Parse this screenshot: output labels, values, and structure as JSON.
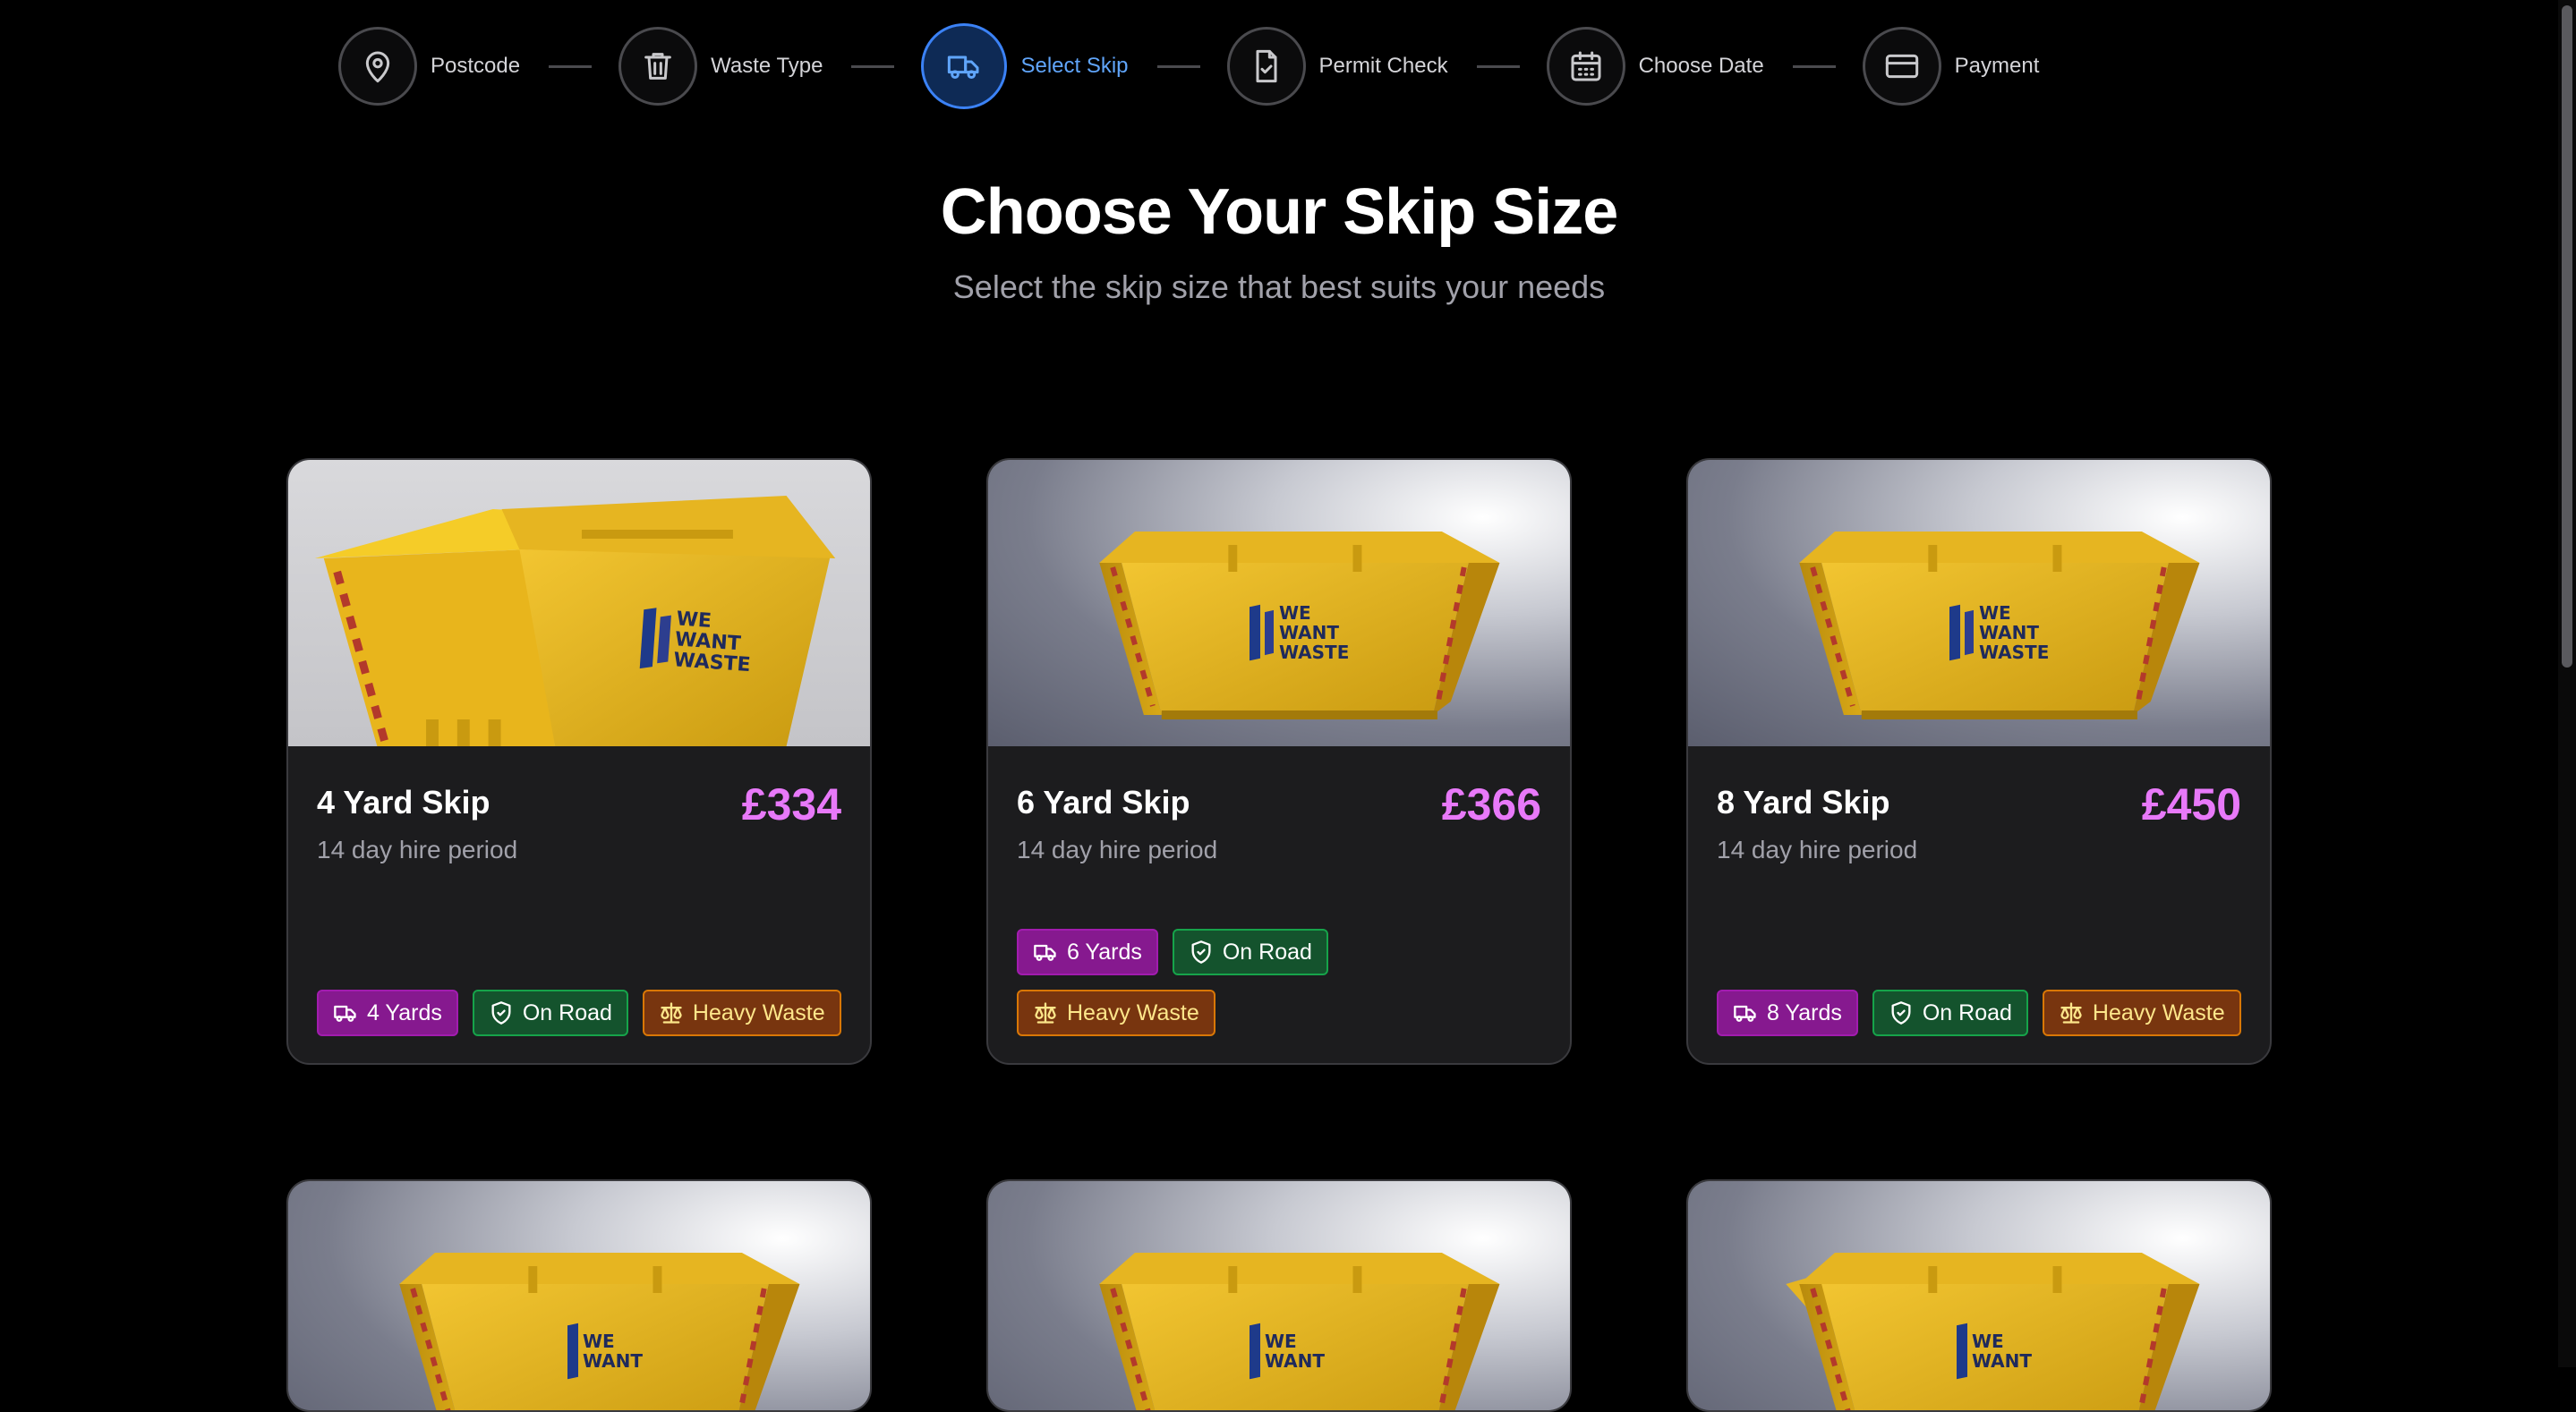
{
  "stepper": {
    "steps": [
      {
        "label": "Postcode",
        "icon": "map-pin-icon"
      },
      {
        "label": "Waste Type",
        "icon": "trash-icon"
      },
      {
        "label": "Select Skip",
        "icon": "truck-icon",
        "active": true
      },
      {
        "label": "Permit Check",
        "icon": "file-check-icon"
      },
      {
        "label": "Choose Date",
        "icon": "calendar-icon"
      },
      {
        "label": "Payment",
        "icon": "credit-card-icon"
      }
    ]
  },
  "heading": {
    "title": "Choose Your Skip Size",
    "subtitle": "Select the skip size that best suits your needs"
  },
  "cards": [
    {
      "title": "4 Yard Skip",
      "price": "£334",
      "hire": "14 day hire period",
      "badges": {
        "yards": "4 Yards",
        "road": "On Road",
        "heavy": "Heavy Waste"
      }
    },
    {
      "title": "6 Yard Skip",
      "price": "£366",
      "hire": "14 day hire period",
      "badges": {
        "yards": "6 Yards",
        "road": "On Road",
        "heavy": "Heavy Waste"
      }
    },
    {
      "title": "8 Yard Skip",
      "price": "£450",
      "hire": "14 day hire period",
      "badges": {
        "yards": "8 Yards",
        "road": "On Road",
        "heavy": "Heavy Waste"
      }
    }
  ],
  "skip_logo": {
    "line1": "WE",
    "line2": "WANT",
    "line3": "WASTE"
  },
  "colors": {
    "accent": "#3b82f6",
    "price": "#e879f9",
    "badge_yards": "#86198f",
    "badge_road": "#14532d",
    "badge_heavy": "#78350f",
    "skip_yellow": "#e0b21a"
  }
}
